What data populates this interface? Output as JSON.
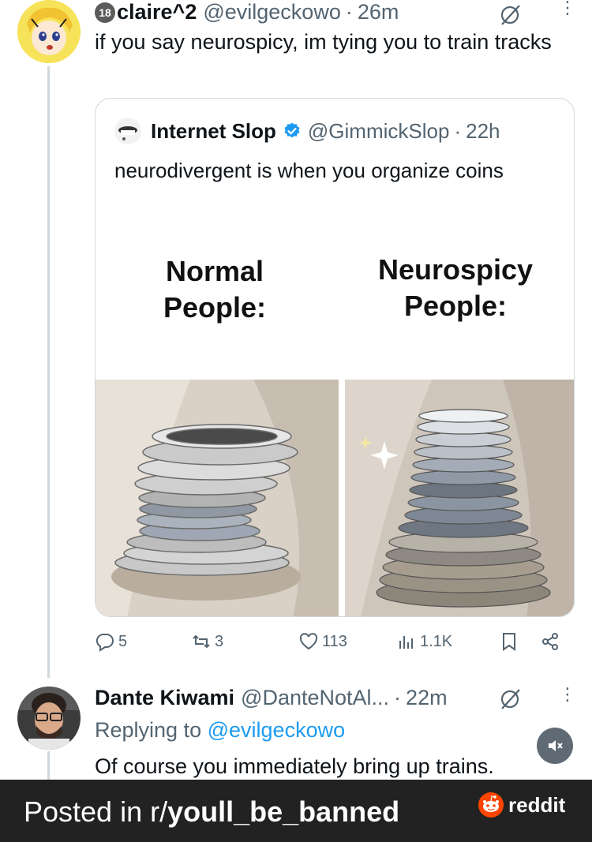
{
  "post": {
    "age_badge": "18",
    "display_name": "claire^2",
    "handle": "@evilgeckowo",
    "separator": "·",
    "time": "26m",
    "text": "if you say neurospicy, im tying you to train tracks"
  },
  "quote": {
    "display_name": "Internet Slop",
    "handle": "@GimmickSlop",
    "separator": "·",
    "time": "22h",
    "text": "neurodivergent is when you organize coins",
    "meme": {
      "left_label_line1": "Normal",
      "left_label_line2": "People:",
      "right_label_line1": "Neurospicy",
      "right_label_line2": "People:"
    }
  },
  "actions": {
    "replies": "5",
    "reposts": "3",
    "likes": "113",
    "views": "1.1K"
  },
  "reply": {
    "display_name": "Dante Kiwami",
    "handle": "@DanteNotAl...",
    "separator": "·",
    "time": "22m",
    "replying_prefix": "Replying to",
    "replying_to": "@evilgeckowo",
    "text": "Of course you immediately bring up trains."
  },
  "footer": {
    "prefix": "Posted in r/",
    "subreddit": "youll_be_banned",
    "brand": "reddit"
  },
  "colors": {
    "verified": "#1d9bf0",
    "reddit_orange": "#ff4500",
    "footer_bg": "#222222",
    "muted_text": "#536471"
  },
  "icons": [
    "grok-icon",
    "more-icon",
    "verified-icon",
    "reply-icon",
    "repost-icon",
    "like-icon",
    "views-icon",
    "bookmark-icon",
    "share-icon",
    "mute-icon",
    "reddit-snoo-icon"
  ]
}
